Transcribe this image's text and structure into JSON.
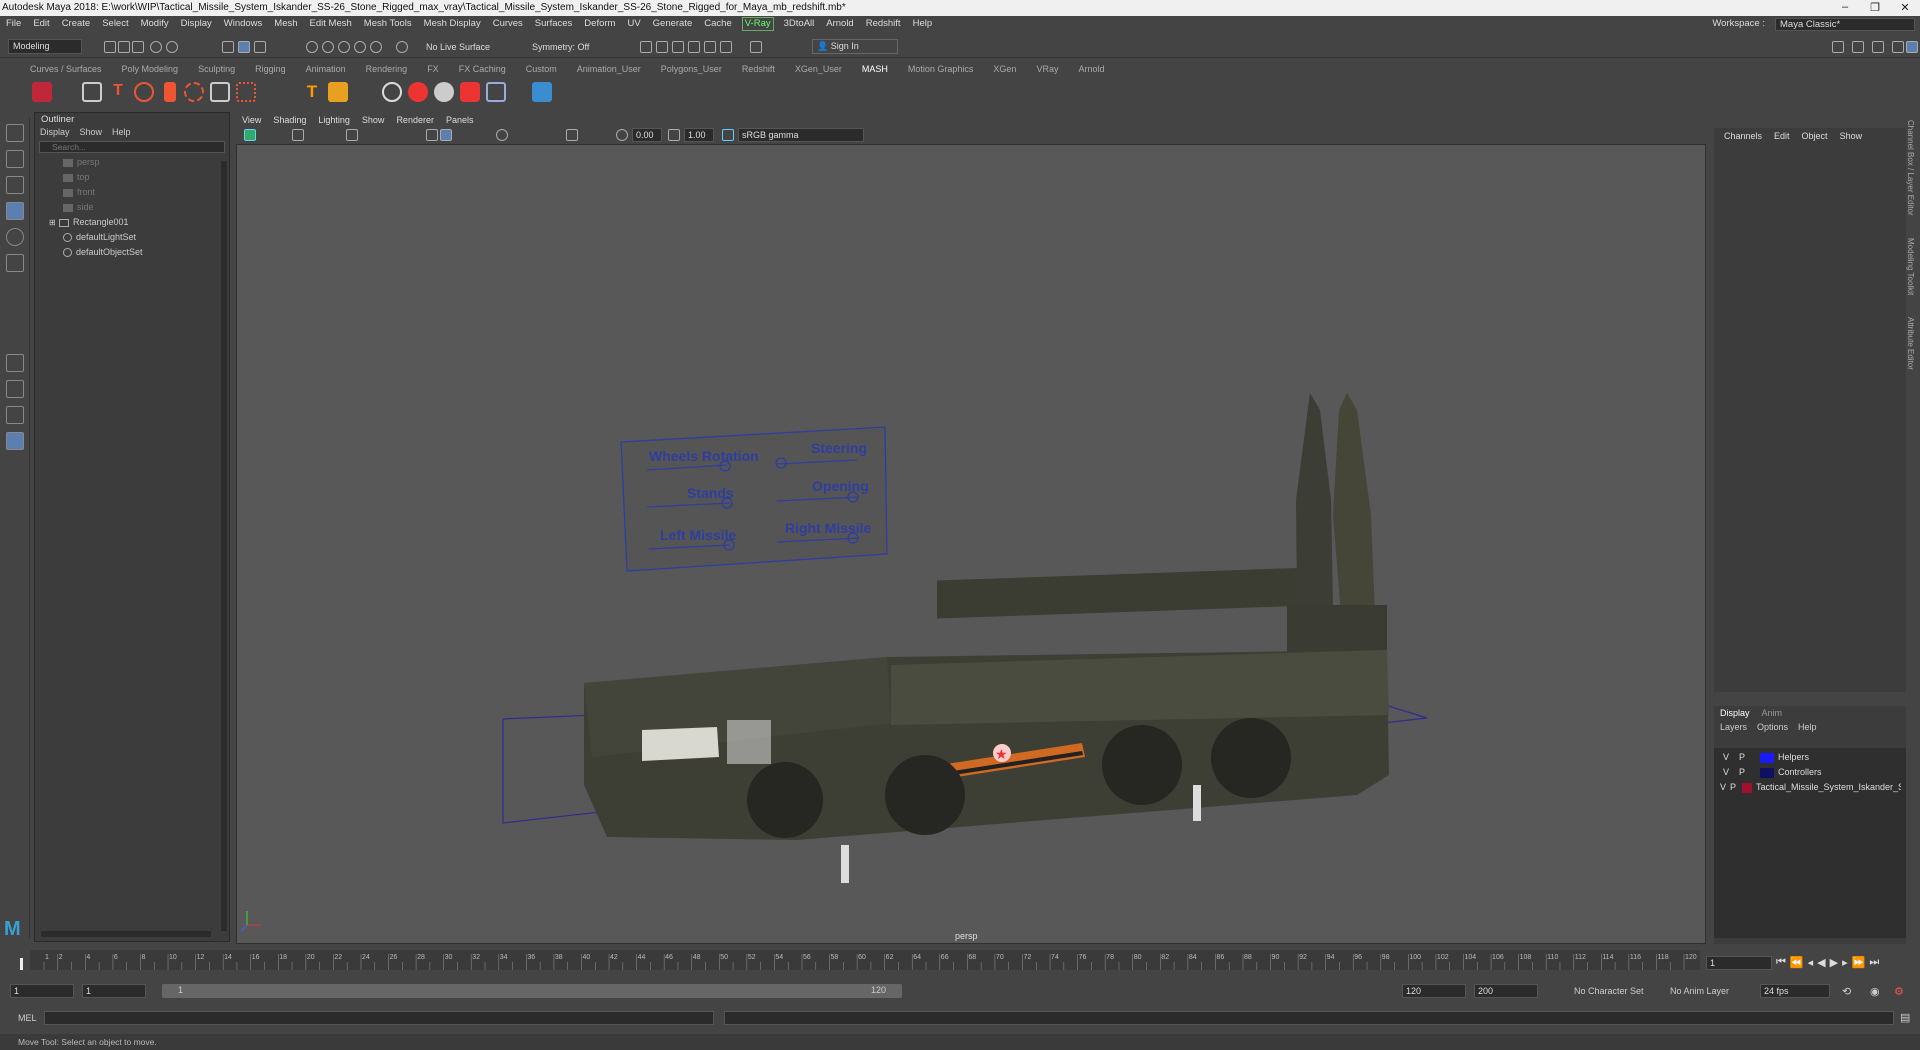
{
  "title": "Autodesk Maya 2018: E:\\work\\WIP\\Tactical_Missile_System_Iskander_SS-26_Stone_Rigged_max_vray\\Tactical_Missile_System_Iskander_SS-26_Stone_Rigged_for_Maya_mb_redshift.mb*",
  "menu": [
    "File",
    "Edit",
    "Create",
    "Select",
    "Modify",
    "Display",
    "Windows",
    "Mesh",
    "Edit Mesh",
    "Mesh Tools",
    "Mesh Display",
    "Curves",
    "Surfaces",
    "Deform",
    "UV",
    "Generate",
    "Cache",
    "V-Ray",
    "3DtoAll",
    "Arnold",
    "Redshift",
    "Help"
  ],
  "workspace": {
    "label": "Workspace :",
    "value": "Maya Classic*"
  },
  "status": {
    "mode": "Modeling",
    "live_surface": "No Live Surface",
    "symmetry": "Symmetry: Off",
    "sign_in": "Sign In"
  },
  "shelf_tabs": [
    "Curves / Surfaces",
    "Poly Modeling",
    "Sculpting",
    "Rigging",
    "Animation",
    "Rendering",
    "FX",
    "FX Caching",
    "Custom",
    "Animation_User",
    "Polygons_User",
    "Redshift",
    "XGen_User",
    "MASH",
    "Motion Graphics",
    "XGen",
    "VRay",
    "Arnold"
  ],
  "shelf_active": "MASH",
  "outliner": {
    "title": "Outliner",
    "menu": [
      "Display",
      "Show",
      "Help"
    ],
    "search_placeholder": "Search...",
    "items": [
      "persp",
      "top",
      "front",
      "side",
      "Rectangle001",
      "defaultLightSet",
      "defaultObjectSet"
    ]
  },
  "viewport": {
    "menu": [
      "View",
      "Shading",
      "Lighting",
      "Show",
      "Renderer",
      "Panels"
    ],
    "exposure": "0.00",
    "gamma": "1.00",
    "color_space": "sRGB gamma",
    "camera": "persp",
    "panel_labels": [
      "Wheels Rotation",
      "Steering",
      "Stands",
      "Opening",
      "Left Missile",
      "Right Missile"
    ]
  },
  "channel_box": {
    "menu": [
      "Channels",
      "Edit",
      "Object",
      "Show"
    ]
  },
  "layer_editor": {
    "tabs": [
      "Display",
      "Anim"
    ],
    "menu": [
      "Layers",
      "Options",
      "Help"
    ],
    "layers": [
      {
        "v": "V",
        "p": "P",
        "name": "Helpers",
        "color": "#1a1aff"
      },
      {
        "v": "V",
        "p": "P",
        "name": "Controllers",
        "color": "#101060"
      },
      {
        "v": "V",
        "p": "P",
        "name": "Tactical_Missile_System_Iskander_SSF",
        "color": "#a01030"
      }
    ]
  },
  "side_tabs": [
    "Channel Box / Layer Editor",
    "Modeling Toolkit",
    "Attribute Editor"
  ],
  "timeline": {
    "ticks": [
      "1",
      "2",
      "4",
      "6",
      "8",
      "10",
      "12",
      "14",
      "16",
      "18",
      "20",
      "22",
      "24",
      "26",
      "28",
      "30",
      "32",
      "34",
      "36",
      "38",
      "40",
      "42",
      "44",
      "46",
      "48",
      "50",
      "52",
      "54",
      "56",
      "58",
      "60",
      "62",
      "64",
      "66",
      "68",
      "70",
      "72",
      "74",
      "76",
      "78",
      "80",
      "82",
      "84",
      "86",
      "88",
      "90",
      "92",
      "94",
      "96",
      "98",
      "100",
      "102",
      "104",
      "106",
      "108",
      "110",
      "112",
      "114",
      "116",
      "118",
      "120"
    ],
    "current": "1"
  },
  "range": {
    "start": "1",
    "start2": "1",
    "inner_start": "1",
    "inner_end": "120",
    "end": "120",
    "end2": "200",
    "char_set": "No Character Set",
    "anim_layer": "No Anim Layer",
    "fps": "24 fps"
  },
  "cmd": {
    "label": "MEL"
  },
  "help_line": "Move Tool: Select an object to move."
}
